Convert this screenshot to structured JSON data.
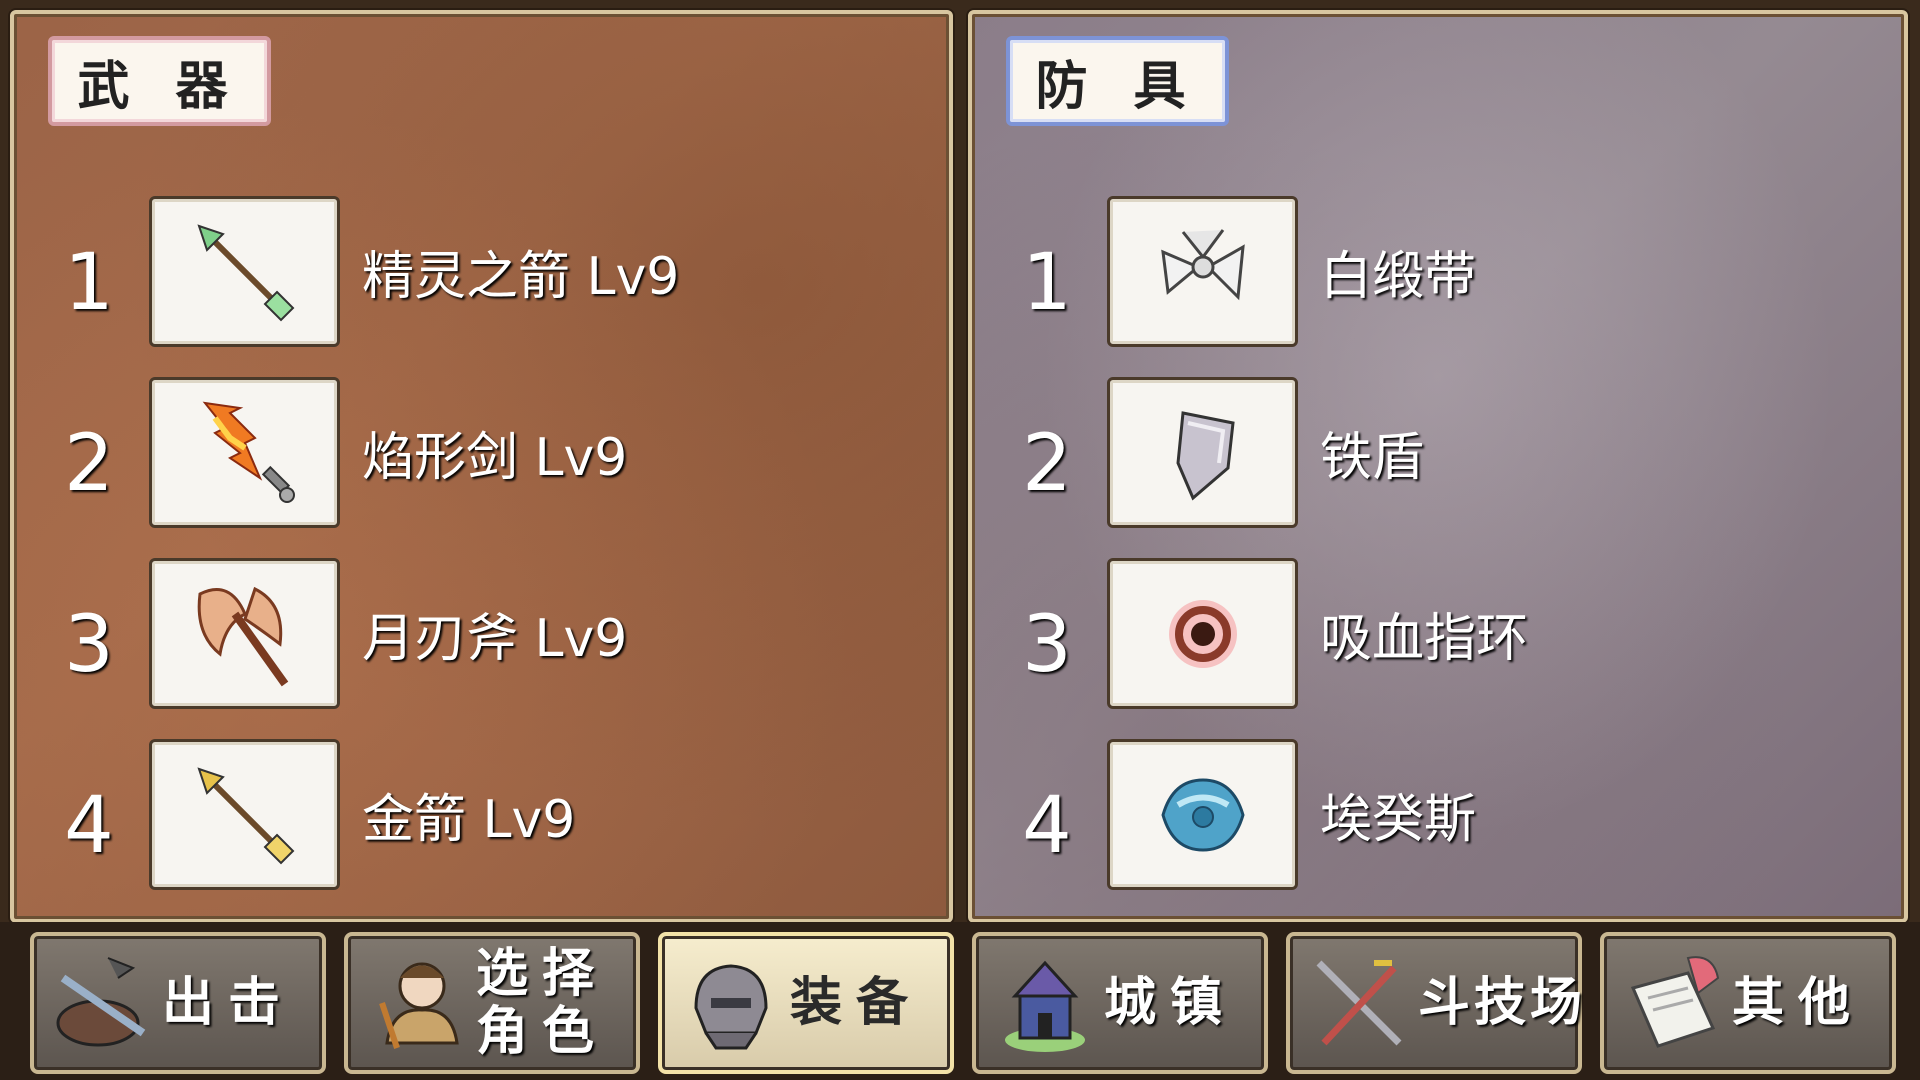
{
  "weapons": {
    "title": "武 器",
    "items": [
      {
        "num": "1",
        "name": "精灵之箭 Lv9",
        "icon": "elf-arrow-icon"
      },
      {
        "num": "2",
        "name": "焰形剑 Lv9",
        "icon": "flame-sword-icon"
      },
      {
        "num": "3",
        "name": "月刃斧 Lv9",
        "icon": "moon-axe-icon"
      },
      {
        "num": "4",
        "name": "金箭 Lv9",
        "icon": "gold-arrow-icon"
      }
    ]
  },
  "armor": {
    "title": "防 具",
    "items": [
      {
        "num": "1",
        "name": "白缎带",
        "icon": "white-ribbon-icon"
      },
      {
        "num": "2",
        "name": "铁盾",
        "icon": "iron-shield-icon"
      },
      {
        "num": "3",
        "name": "吸血指环",
        "icon": "vampire-ring-icon"
      },
      {
        "num": "4",
        "name": "埃癸斯",
        "icon": "aegis-icon"
      }
    ]
  },
  "nav": [
    {
      "label": "出击",
      "icon": "sortie-icon"
    },
    {
      "label_line1": "选择",
      "label_line2": "角色",
      "icon": "character-icon"
    },
    {
      "label": "装备",
      "icon": "armor-helmet-icon",
      "active": true
    },
    {
      "label": "城镇",
      "icon": "town-icon"
    },
    {
      "label": "斗技场",
      "icon": "arena-swords-icon"
    },
    {
      "label": "其他",
      "icon": "scroll-icon"
    }
  ],
  "colors": {
    "weapons_bg": "#9c6447",
    "armor_bg": "#8b7d89",
    "weapons_tag_border": "#d39aa0",
    "armor_tag_border": "#7d93d6",
    "active_button": "#f6edce"
  }
}
